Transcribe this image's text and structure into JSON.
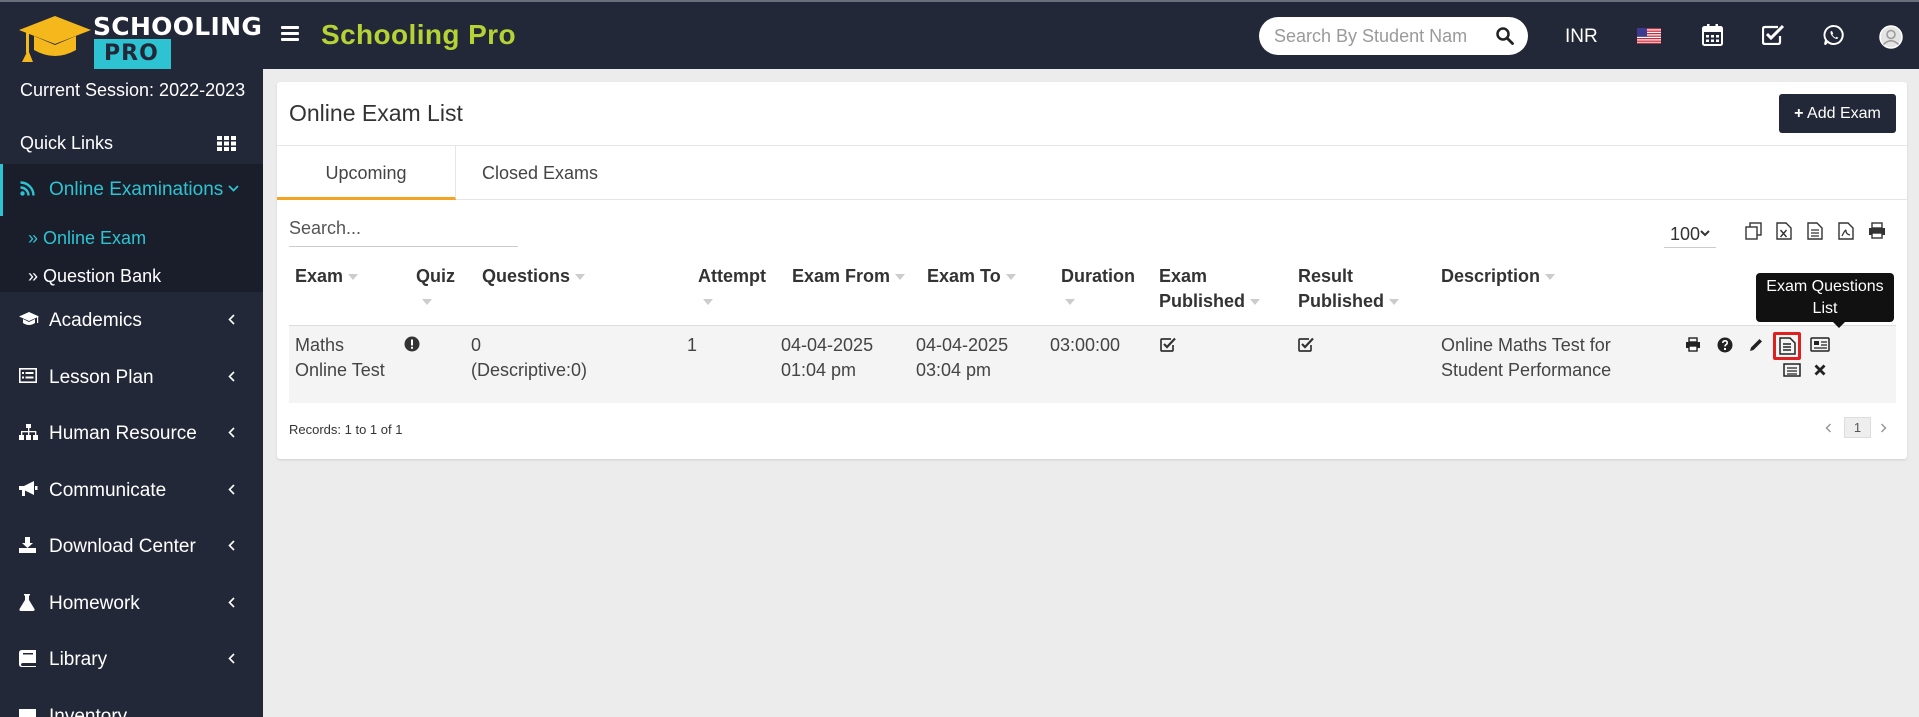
{
  "brand": {
    "logo_line1": "SCHOOLING",
    "logo_line2": "PRO",
    "title": "Schooling Pro"
  },
  "header": {
    "search_placeholder": "Search By Student Nam",
    "currency": "INR",
    "icons": [
      "flag-us-icon",
      "calendar-icon",
      "check-square-icon",
      "whatsapp-icon",
      "user-avatar-icon"
    ]
  },
  "sidebar": {
    "session": "Current Session: 2022-2023",
    "quick_links": "Quick Links",
    "active_section": "Online Examinations",
    "sub_items": [
      "Online Exam",
      "Question Bank"
    ],
    "items": [
      {
        "label": "Academics",
        "icon": "graduation-cap-icon"
      },
      {
        "label": "Lesson Plan",
        "icon": "list-icon"
      },
      {
        "label": "Human Resource",
        "icon": "sitemap-icon"
      },
      {
        "label": "Communicate",
        "icon": "bullhorn-icon"
      },
      {
        "label": "Download Center",
        "icon": "download-icon"
      },
      {
        "label": "Homework",
        "icon": "flask-icon"
      },
      {
        "label": "Library",
        "icon": "book-icon"
      },
      {
        "label": "Inventory",
        "icon": "inventory-icon"
      }
    ]
  },
  "main": {
    "title": "Online Exam List",
    "add_button": "Add Exam",
    "tabs": [
      "Upcoming Exams",
      "Closed Exams"
    ],
    "search_placeholder": "Search...",
    "page_size": "100",
    "columns": [
      "Exam",
      "Quiz",
      "Questions",
      "Attempt",
      "Exam From",
      "Exam To",
      "Duration",
      "Exam Published",
      "Result Published",
      "Description"
    ],
    "rows": [
      {
        "exam": "Maths Online Test",
        "questions": "0",
        "questions_detail": "(Descriptive:0)",
        "attempt": "1",
        "from_date": "04-04-2025",
        "from_time": "01:04 pm",
        "to_date": "04-04-2025",
        "to_time": "03:04 pm",
        "duration": "03:00:00",
        "description": "Online Maths Test for Student Performance"
      }
    ],
    "tooltip": "Exam Questions List",
    "records": "Records: 1 to 1 of 1",
    "current_page": "1"
  },
  "colors": {
    "sidebar_bg": "#232838",
    "accent": "#2dc3d3",
    "brand_green": "#b5d335",
    "tab_underline": "#f3a521"
  }
}
